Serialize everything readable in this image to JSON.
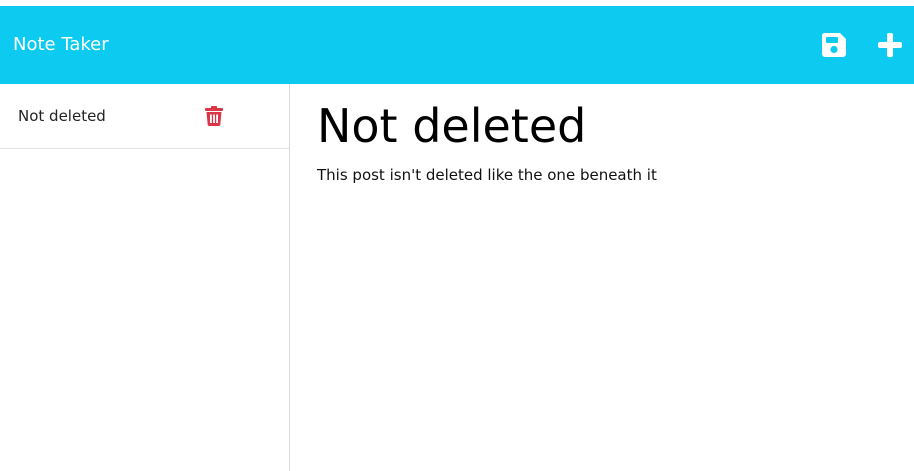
{
  "app": {
    "title": "Note Taker",
    "accent_color": "#0dcaf0",
    "danger_color": "#dc3545"
  },
  "toolbar": {
    "save_icon": "save-icon",
    "add_icon": "plus-icon"
  },
  "sidebar": {
    "items": [
      {
        "label": "Not deleted",
        "action_icon": "trash-icon"
      }
    ]
  },
  "note": {
    "title": "Not deleted",
    "body": "This post isn't deleted like the one beneath it"
  }
}
